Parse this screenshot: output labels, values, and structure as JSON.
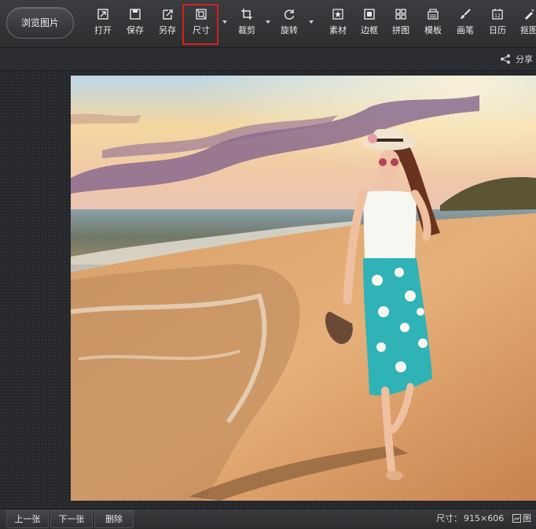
{
  "toolbar": {
    "browse_label": "浏览图片",
    "tools": [
      {
        "icon": "open-icon",
        "label": "打开"
      },
      {
        "icon": "save-icon",
        "label": "保存"
      },
      {
        "icon": "save-as-icon",
        "label": "另存"
      },
      {
        "icon": "resize-icon",
        "label": "尺寸"
      },
      {
        "icon": "crop-icon",
        "label": "裁剪"
      },
      {
        "icon": "rotate-icon",
        "label": "旋转"
      },
      {
        "icon": "material-icon",
        "label": "素材"
      },
      {
        "icon": "border-icon",
        "label": "边框"
      },
      {
        "icon": "collage-icon",
        "label": "拼图"
      },
      {
        "icon": "template-icon",
        "label": "模板"
      },
      {
        "icon": "brush-icon",
        "label": "画笔"
      },
      {
        "icon": "calendar-icon",
        "label": "日历"
      },
      {
        "icon": "cutout-icon",
        "label": "抠图"
      }
    ],
    "highlight_color": "#d8201d"
  },
  "subbar": {
    "share_label": "分享"
  },
  "bottom": {
    "prev_label": "上一张",
    "next_label": "下一张",
    "delete_label": "删除",
    "size_label": "尺寸：",
    "size_value": "915×606",
    "right_label": "图"
  }
}
